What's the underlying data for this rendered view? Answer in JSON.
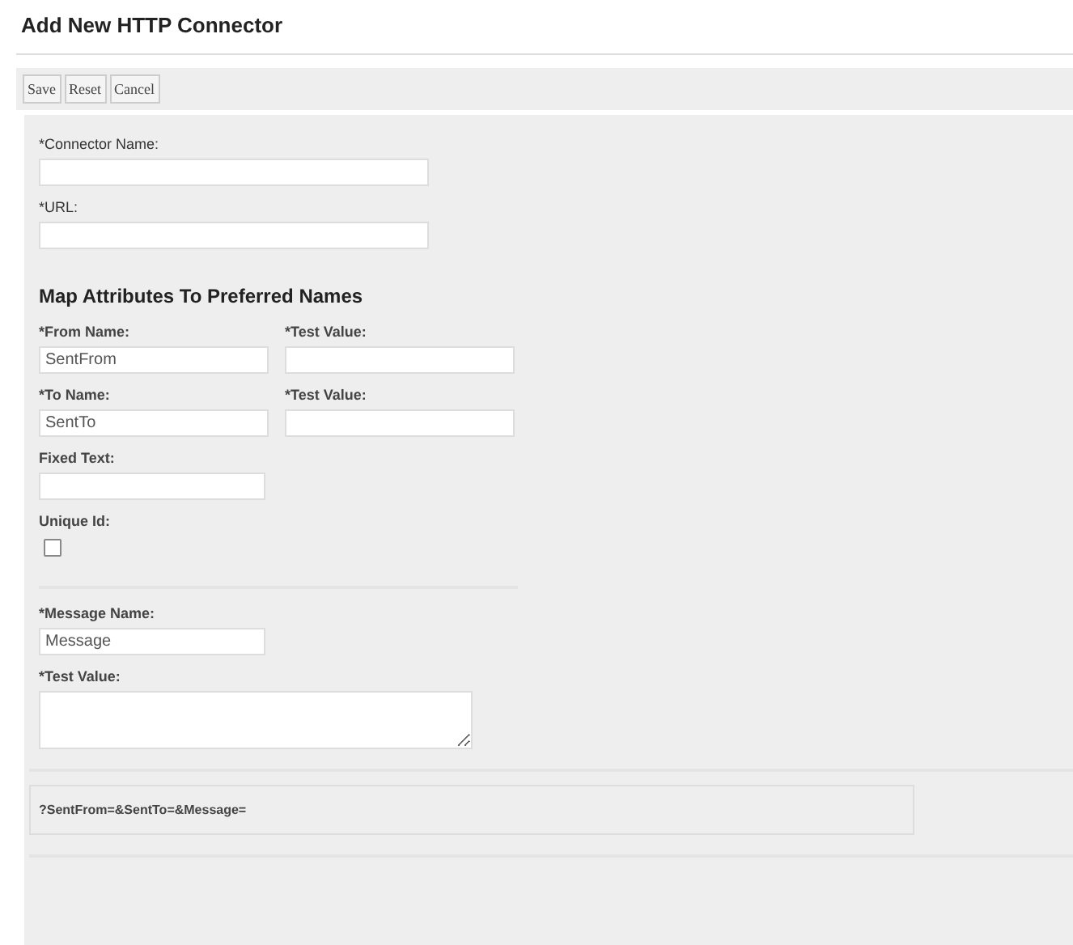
{
  "title": "Add New HTTP Connector",
  "toolbar": [
    "Save",
    "Reset",
    "Cancel"
  ],
  "connector_fields": [
    {
      "label": "*Connector Name:"
    },
    {
      "label": "*URL:"
    }
  ],
  "map_section": {
    "heading": "Map Attributes To Preferred Names",
    "pairs": [
      {
        "name_label": "*From Name:",
        "name_value": "SentFrom",
        "test_label": "*Test Value:"
      },
      {
        "name_label": "*To Name:",
        "name_value": "SentTo",
        "test_label": "*Test Value:"
      }
    ],
    "fixed_text": {
      "label": "Fixed Text:"
    },
    "unique_id": {
      "label": "Unique Id:",
      "checked": false
    }
  },
  "message": {
    "name_label": "*Message Name:",
    "name_value": "Message",
    "test_label": "*Test Value:"
  },
  "query_preview": "?SentFrom=&SentTo=&Message="
}
